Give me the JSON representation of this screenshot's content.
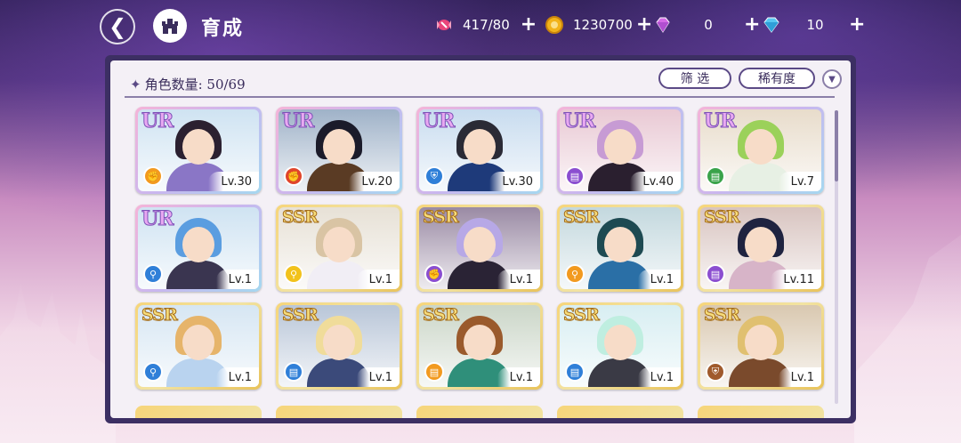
{
  "header": {
    "title": "育成",
    "resources": [
      {
        "name": "candy",
        "value": "417/80",
        "color": "#e8457a"
      },
      {
        "name": "gold-coin",
        "value": "1230700",
        "color": "#f2b31b"
      },
      {
        "name": "pink-gem",
        "value": "0",
        "color": "#d46ae6"
      },
      {
        "name": "blue-diamond",
        "value": "10",
        "color": "#58c7f2"
      }
    ]
  },
  "panel": {
    "count_label": "角色数量: 50/69",
    "filter_label": "筛 选",
    "rarity_label": "稀有度"
  },
  "characters": [
    {
      "rarity": "UR",
      "level": "Lv.30",
      "class": "fist",
      "class_color": "#f29a1f",
      "hair": "#2b2030",
      "outfit": "#8a76c6",
      "bg": "#cfe3f2"
    },
    {
      "rarity": "UR",
      "level": "Lv.20",
      "class": "fist",
      "class_color": "#e0452b",
      "hair": "#1b1b2a",
      "outfit": "#5a3b24",
      "bg": "#9fb2c8"
    },
    {
      "rarity": "UR",
      "level": "Lv.30",
      "class": "shield",
      "class_color": "#2f7fd8",
      "hair": "#2a2a35",
      "outfit": "#1e3a7a",
      "bg": "#c8dcef"
    },
    {
      "rarity": "UR",
      "level": "Lv.40",
      "class": "book",
      "class_color": "#8b4ed0",
      "hair": "#c79bd4",
      "outfit": "#2a1f2f",
      "bg": "#e9c9d4"
    },
    {
      "rarity": "UR",
      "level": "Lv.7",
      "class": "book",
      "class_color": "#3aa34a",
      "hair": "#9bd15a",
      "outfit": "#e7f0e4",
      "bg": "#e8dccb"
    },
    {
      "rarity": "UR",
      "level": "Lv.1",
      "class": "wand",
      "class_color": "#2f7fd8",
      "hair": "#5a9de0",
      "outfit": "#3a3550",
      "bg": "#cfe3f2"
    },
    {
      "rarity": "SSR",
      "level": "Lv.1",
      "class": "wand",
      "class_color": "#f2c21b",
      "hair": "#d9c4a4",
      "outfit": "#f1eef5",
      "bg": "#e7e1d6"
    },
    {
      "rarity": "SSR",
      "level": "Lv.1",
      "class": "fist",
      "class_color": "#8b4ed0",
      "hair": "#b7a8e6",
      "outfit": "#2a2335",
      "bg": "#9a8aa4"
    },
    {
      "rarity": "SSR",
      "level": "Lv.1",
      "class": "wand",
      "class_color": "#f29a1f",
      "hair": "#1e4a52",
      "outfit": "#2a6fa6",
      "bg": "#c3d8de"
    },
    {
      "rarity": "SSR",
      "level": "Lv.11",
      "class": "book",
      "class_color": "#8b4ed0",
      "hair": "#1f2340",
      "outfit": "#d7b4c8",
      "bg": "#d8c4c0"
    },
    {
      "rarity": "SSR",
      "level": "Lv.1",
      "class": "wand",
      "class_color": "#2f7fd8",
      "hair": "#e6b46a",
      "outfit": "#b9d3ef",
      "bg": "#d6e6f3"
    },
    {
      "rarity": "SSR",
      "level": "Lv.1",
      "class": "book",
      "class_color": "#2f7fd8",
      "hair": "#f0dc9a",
      "outfit": "#3b4a7a",
      "bg": "#b9c6d8"
    },
    {
      "rarity": "SSR",
      "level": "Lv.1",
      "class": "book",
      "class_color": "#f29a1f",
      "hair": "#9a5a2c",
      "outfit": "#2f8f7a",
      "bg": "#cbd6c8"
    },
    {
      "rarity": "SSR",
      "level": "Lv.1",
      "class": "book",
      "class_color": "#2f7fd8",
      "hair": "#bfeee0",
      "outfit": "#3a3a45",
      "bg": "#d8eef2"
    },
    {
      "rarity": "SSR",
      "level": "Lv.1",
      "class": "shield",
      "class_color": "#a05a2c",
      "hair": "#e0c070",
      "outfit": "#7a4a2c",
      "bg": "#d9c8b0"
    }
  ]
}
